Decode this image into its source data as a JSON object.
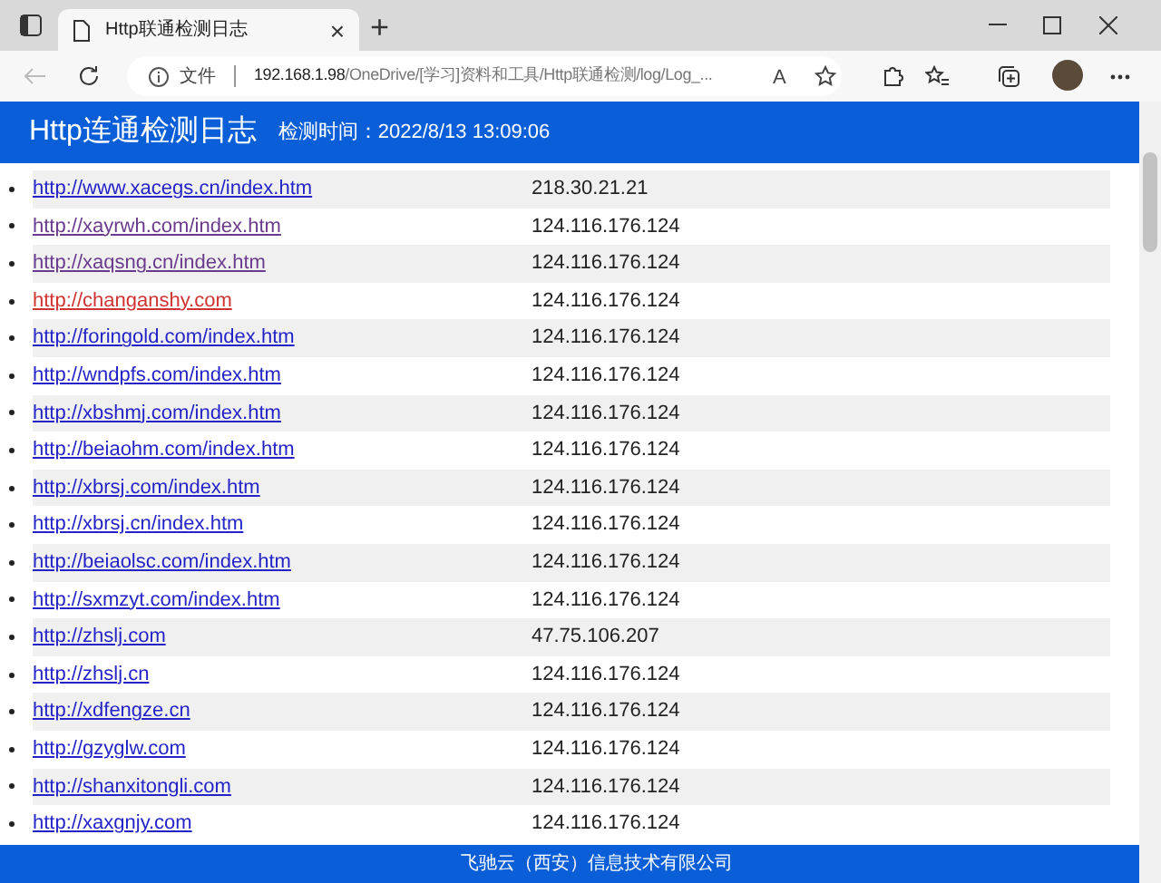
{
  "browser": {
    "tab_title": "Http联通检测日志",
    "tab_close": "×",
    "new_tab": "+",
    "address_label": "文件",
    "url_host": "192.168.1.98",
    "url_path": "/OneDrive/[学习]资料和工具/Http联通检测/log/Log_...",
    "read_aloud": "A"
  },
  "header": {
    "title": "Http连通检测日志",
    "check_time": "检测时间：2022/8/13 13:09:06"
  },
  "rows": [
    {
      "url": "http://www.xacegs.cn/index.htm",
      "ip": "218.30.21.21",
      "color": "#2323c8"
    },
    {
      "url": "http://xayrwh.com/index.htm",
      "ip": "124.116.176.124",
      "color": "#6a3a8c"
    },
    {
      "url": "http://xaqsng.cn/index.htm",
      "ip": "124.116.176.124",
      "color": "#6a3a8c"
    },
    {
      "url": "http://changanshy.com",
      "ip": "124.116.176.124",
      "color": "#d03232"
    },
    {
      "url": "http://foringold.com/index.htm",
      "ip": "124.116.176.124",
      "color": "#2323c8"
    },
    {
      "url": "http://wndpfs.com/index.htm",
      "ip": "124.116.176.124",
      "color": "#2323c8"
    },
    {
      "url": "http://xbshmj.com/index.htm",
      "ip": "124.116.176.124",
      "color": "#2323c8"
    },
    {
      "url": "http://beiaohm.com/index.htm",
      "ip": "124.116.176.124",
      "color": "#2323c8"
    },
    {
      "url": "http://xbrsj.com/index.htm",
      "ip": "124.116.176.124",
      "color": "#2323c8"
    },
    {
      "url": "http://xbrsj.cn/index.htm",
      "ip": "124.116.176.124",
      "color": "#2323c8"
    },
    {
      "url": "http://beiaolsc.com/index.htm",
      "ip": "124.116.176.124",
      "color": "#2323c8"
    },
    {
      "url": "http://sxmzyt.com/index.htm",
      "ip": "124.116.176.124",
      "color": "#2323c8"
    },
    {
      "url": "http://zhslj.com",
      "ip": "47.75.106.207",
      "color": "#2323c8"
    },
    {
      "url": "http://zhslj.cn",
      "ip": "124.116.176.124",
      "color": "#2323c8"
    },
    {
      "url": "http://xdfengze.cn",
      "ip": "124.116.176.124",
      "color": "#2323c8"
    },
    {
      "url": "http://gzyglw.com",
      "ip": "124.116.176.124",
      "color": "#2323c8"
    },
    {
      "url": "http://shanxitongli.com",
      "ip": "124.116.176.124",
      "color": "#2323c8"
    },
    {
      "url": "http://xaxgnjy.com",
      "ip": "124.116.176.124",
      "color": "#2323c8"
    }
  ],
  "footer": {
    "text": "飞驰云（西安）信息技术有限公司"
  }
}
